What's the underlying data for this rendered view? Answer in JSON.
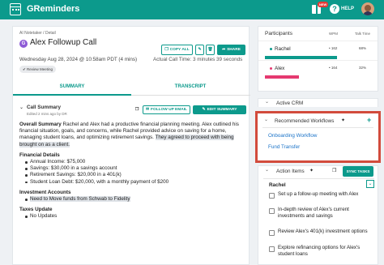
{
  "app": {
    "title": "GReminders",
    "new_badge": "NEW",
    "help_label": "HELP"
  },
  "main": {
    "breadcrumb": "AI Notetaker / Detail",
    "meeting_initial": "G",
    "meeting_title": "Alex Followup Call",
    "meeting_date": "Wednesday Aug 28, 2024 @ 10:58am PDT (4 mins)",
    "actual_time": "Actual Call Time: 3 minutes 39 seconds",
    "badge": "Review Meeting",
    "copy_all": "COPY ALL",
    "share": "SHARE",
    "tabs": [
      "SUMMARY",
      "TRANSCRIPT"
    ],
    "summary": {
      "title": "Call Summary",
      "subtitle": "Edited 2 mins ago by DR",
      "follow_up_email": "FOLLOW UP EMAIL",
      "edit_summary": "EDIT SUMMARY",
      "overall_label": "Overall Summary",
      "overall_text_a": " Rachel and Alex had a productive financial planning meeting. Alex outlined his financial situation, goals, and concerns, while Rachel provided advice on saving for a home, managing student loans, and optimizing retirement savings. ",
      "overall_text_hl": "They agreed to proceed with being brought on as a client.",
      "financial_header": "Financial Details",
      "financial_items": [
        "Annual Income: $75,000",
        "Savings: $30,000 in a savings account",
        "Retirement Savings: $20,000 in a 401(k)",
        "Student Loan Debt: $20,000, with a monthly payment of $200"
      ],
      "investment_header": "Investment Accounts",
      "investment_items": [
        "Need to Move funds from Schwab to Fidelity"
      ],
      "taxes_header": "Taxes Update",
      "taxes_items": [
        "No Updates"
      ]
    }
  },
  "participants": {
    "title": "Participants",
    "col_wpm": "WPM",
    "col_talk": "Talk Time",
    "rows": [
      {
        "name": "Rachel",
        "wpm": "162",
        "talk": "68%",
        "fraction": 0.68,
        "color": "#0c9a8c"
      },
      {
        "name": "Alex",
        "wpm": "164",
        "talk": "32%",
        "fraction": 0.32,
        "color": "#e53970"
      }
    ]
  },
  "crm": {
    "title": "Active CRM"
  },
  "workflows": {
    "title": "Recommended Workflows",
    "items": [
      "Onboarding Workflow",
      "Fund Transfer"
    ]
  },
  "action_items": {
    "title": "Action Items",
    "sync": "SYNC TASKS",
    "owner": "Rachel",
    "items": [
      "Set up a follow-up meeting with Alex",
      "In-depth review of Alex's current investments and savings",
      "Review Alex's 401(k) investment options",
      "Explore refinancing options for Alex's student loans"
    ]
  },
  "colors": {
    "accent": "#0c9a8c",
    "highlight_frame": "#d24b3c",
    "meeting_badge": "#8e5bd6"
  }
}
